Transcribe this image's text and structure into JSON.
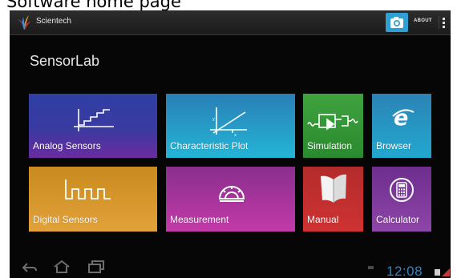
{
  "caption": "Software home page",
  "app": {
    "name": "Scientech",
    "about_label": "ABOUT"
  },
  "page_title": "SensorLab",
  "tiles": [
    {
      "label": "Analog Sensors",
      "icon": "step-graph-icon",
      "color": "#3a3aa0"
    },
    {
      "label": "Characteristic Plot",
      "icon": "line-graph-icon",
      "color": "#2a9cc6"
    },
    {
      "label": "Simulation",
      "icon": "simulation-icon",
      "color": "#3a9a38"
    },
    {
      "label": "Browser",
      "icon": "internet-explorer-icon",
      "color": "#2596c4"
    },
    {
      "label": "Digital Sensors",
      "icon": "square-wave-icon",
      "color": "#d89630"
    },
    {
      "label": "Measurement",
      "icon": "protractor-icon",
      "color": "#a8369c"
    },
    {
      "label": "Manual",
      "icon": "book-icon",
      "color": "#c22f2f"
    },
    {
      "label": "Calculator",
      "icon": "calculator-icon",
      "color": "#7d3a9b"
    }
  ],
  "status": {
    "time": "12:08"
  },
  "colors": {
    "accent": "#2f9fd4",
    "background": "#060606"
  }
}
